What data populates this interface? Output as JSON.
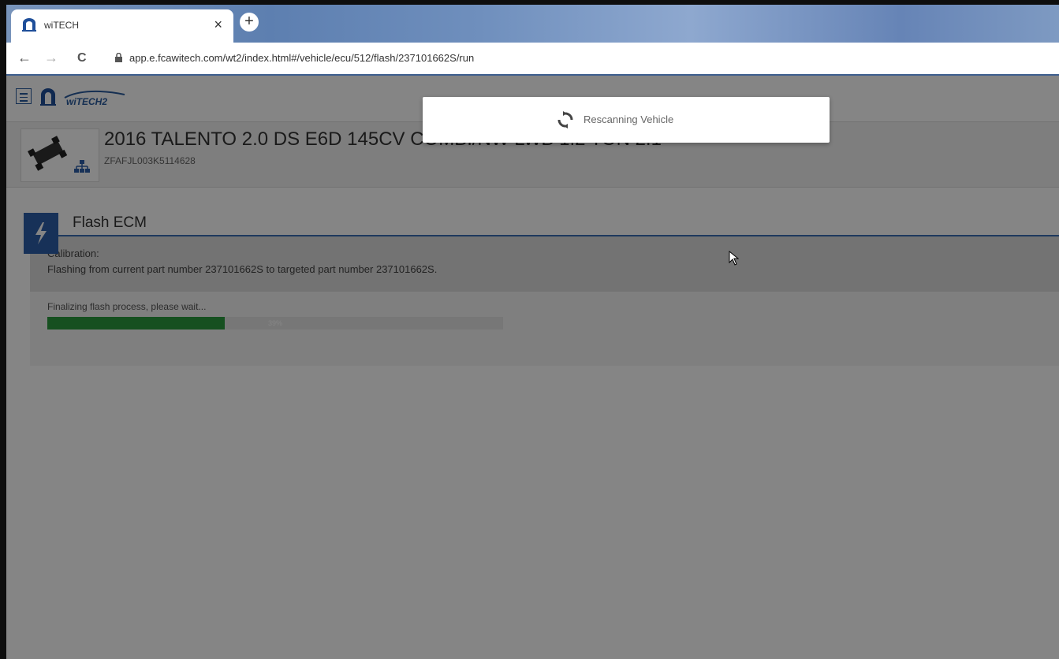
{
  "browser": {
    "tab_title": "wiTECH",
    "tab_close": "×",
    "new_tab": "+",
    "nav": {
      "back": "←",
      "forward": "→",
      "reload": "C"
    },
    "url": "app.e.fcawitech.com/wt2/index.html#/vehicle/ecu/512/flash/237101662S/run"
  },
  "app": {
    "logo_text": "wiTECH2"
  },
  "vehicle": {
    "title": "2016 TALENTO 2.0 DS E6D 145CV COMBI/NW LWB 1.2 TON 2.1",
    "vin": "ZFAFJL003K5114628"
  },
  "flash": {
    "title": "Flash ECM",
    "calibration_label": "Calibration:",
    "calibration_text": "Flashing from current part number 237101662S to targeted part number 237101662S.",
    "progress_label": "Finalizing flash process, please wait...",
    "progress_value": 39,
    "progress_text": "39%"
  },
  "modal": {
    "message": "Rescanning Vehicle"
  },
  "colors": {
    "accent": "#2c5faa",
    "progress": "#2b9a3e"
  }
}
